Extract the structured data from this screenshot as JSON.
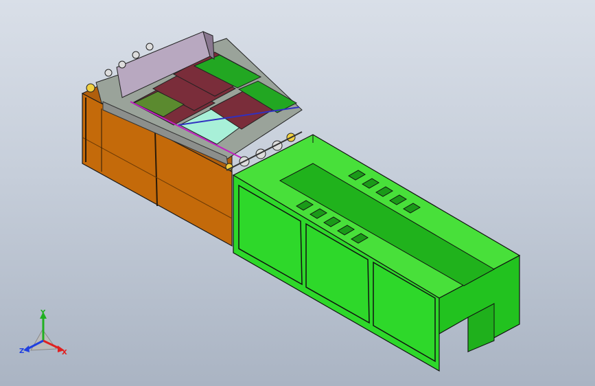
{
  "viewport": {
    "background_top": "#d9dfe8",
    "background_bottom": "#aab4c3"
  },
  "model": {
    "frame_color": "#c46a0a",
    "tank_color": "#2ee02a",
    "conveyor_panel_colors": [
      "#7a2d3a",
      "#22a722",
      "#a8f0d8",
      "#5b8a2f"
    ]
  },
  "triad": {
    "x_label": "X",
    "y_label": "Y",
    "z_label": "Z",
    "x_color": "#e02020",
    "y_color": "#20b020",
    "z_color": "#2040e0"
  }
}
